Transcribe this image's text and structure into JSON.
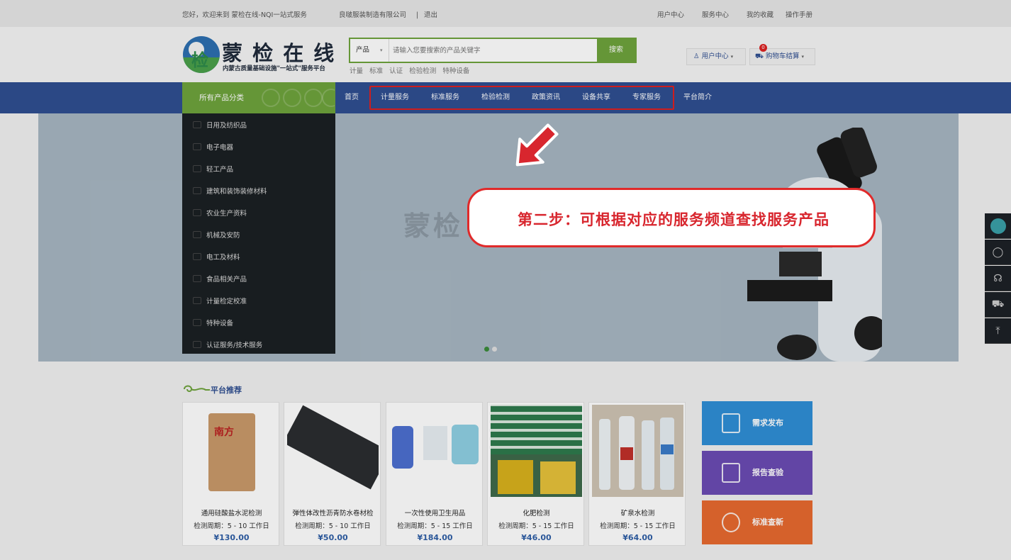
{
  "topbar": {
    "welcome": "您好，欢迎来到  蒙检在线-NQI一站式服务",
    "company": "良啵服装制造有限公司",
    "sep": "|",
    "logout": "退出",
    "links": [
      "用户中心",
      "服务中心",
      "我的收藏",
      "操作手册"
    ]
  },
  "logo": {
    "title": "蒙 检 在 线",
    "subtitle": "内蒙古质量基础设施\"一站式\"服务平台",
    "badge": "检"
  },
  "search": {
    "category": "产品",
    "placeholder": "请输入您要搜索的产品关键字",
    "button": "搜索",
    "hot": [
      "计量",
      "标准",
      "认证",
      "检验检测",
      "特种设备"
    ]
  },
  "header_right": {
    "user_center": "用户中心",
    "cart": "购物车结算",
    "cart_count": "0"
  },
  "nav": {
    "all": "所有产品分类",
    "items": [
      "首页",
      "计量服务",
      "标准服务",
      "检验检测",
      "政策资讯",
      "设备共享",
      "专家服务",
      "平台简介"
    ]
  },
  "categories": [
    "日用及纺织品",
    "电子电器",
    "轻工产品",
    "建筑和装饰装修材料",
    "农业生产资料",
    "机械及安防",
    "电工及材料",
    "食品相关产品",
    "计量检定校准",
    "特种设备",
    "认证服务/技术服务"
  ],
  "banner": {
    "text": "蒙检"
  },
  "callout": {
    "text": "第二步：可根据对应的服务频道查找服务产品"
  },
  "recommend": {
    "title": "平台推荐",
    "products": [
      {
        "name": "通用硅酸盐水泥检测",
        "cycle": "检测周期：5 - 10 工作日",
        "price": "¥130.00"
      },
      {
        "name": "弹性体改性沥青防水卷材检",
        "cycle": "检测周期：5 - 10 工作日",
        "price": "¥50.00"
      },
      {
        "name": "一次性使用卫生用品",
        "cycle": "检测周期：5 - 15 工作日",
        "price": "¥184.00"
      },
      {
        "name": "化肥检测",
        "cycle": "检测周期：5 - 15 工作日",
        "price": "¥46.00"
      },
      {
        "name": "矿泉水检测",
        "cycle": "检测周期：5 - 15 工作日",
        "price": "¥64.00"
      }
    ],
    "actions": [
      "需求发布",
      "报告查验",
      "标准查新"
    ]
  },
  "colors": {
    "nav": "#2f4f91",
    "green": "#6ea33c",
    "callout_red": "#e02a2a",
    "price": "#2f5fa6"
  }
}
